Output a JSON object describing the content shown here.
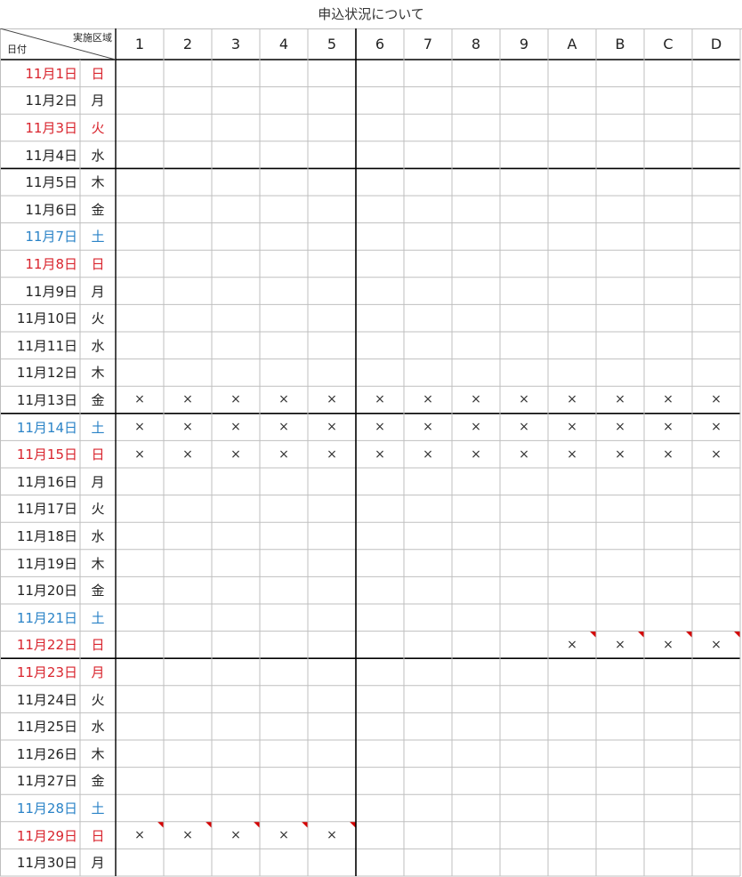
{
  "title": "申込状況について",
  "header": {
    "date_label": "日付",
    "area_label": "実施区域"
  },
  "areas": [
    "1",
    "2",
    "3",
    "4",
    "5",
    "6",
    "7",
    "8",
    "9",
    "A",
    "B",
    "C",
    "D"
  ],
  "rows": [
    {
      "date": "11月1日",
      "dow": "日",
      "color": "red",
      "marks": []
    },
    {
      "date": "11月2日",
      "dow": "月",
      "color": "",
      "marks": []
    },
    {
      "date": "11月3日",
      "dow": "火",
      "color": "red",
      "marks": []
    },
    {
      "date": "11月4日",
      "dow": "水",
      "color": "",
      "marks": []
    },
    {
      "date": "11月5日",
      "dow": "木",
      "color": "",
      "marks": []
    },
    {
      "date": "11月6日",
      "dow": "金",
      "color": "",
      "marks": []
    },
    {
      "date": "11月7日",
      "dow": "土",
      "color": "blue",
      "marks": []
    },
    {
      "date": "11月8日",
      "dow": "日",
      "color": "red",
      "marks": []
    },
    {
      "date": "11月9日",
      "dow": "月",
      "color": "",
      "marks": []
    },
    {
      "date": "11月10日",
      "dow": "火",
      "color": "",
      "marks": []
    },
    {
      "date": "11月11日",
      "dow": "水",
      "color": "",
      "marks": []
    },
    {
      "date": "11月12日",
      "dow": "木",
      "color": "",
      "marks": []
    },
    {
      "date": "11月13日",
      "dow": "金",
      "color": "",
      "marks": [
        "1",
        "2",
        "3",
        "4",
        "5",
        "6",
        "7",
        "8",
        "9",
        "A",
        "B",
        "C",
        "D"
      ]
    },
    {
      "date": "11月14日",
      "dow": "土",
      "color": "blue",
      "marks": [
        "1",
        "2",
        "3",
        "4",
        "5",
        "6",
        "7",
        "8",
        "9",
        "A",
        "B",
        "C",
        "D"
      ]
    },
    {
      "date": "11月15日",
      "dow": "日",
      "color": "red",
      "marks": [
        "1",
        "2",
        "3",
        "4",
        "5",
        "6",
        "7",
        "8",
        "9",
        "A",
        "B",
        "C",
        "D"
      ]
    },
    {
      "date": "11月16日",
      "dow": "月",
      "color": "",
      "marks": []
    },
    {
      "date": "11月17日",
      "dow": "火",
      "color": "",
      "marks": []
    },
    {
      "date": "11月18日",
      "dow": "水",
      "color": "",
      "marks": []
    },
    {
      "date": "11月19日",
      "dow": "木",
      "color": "",
      "marks": []
    },
    {
      "date": "11月20日",
      "dow": "金",
      "color": "",
      "marks": []
    },
    {
      "date": "11月21日",
      "dow": "土",
      "color": "blue",
      "marks": []
    },
    {
      "date": "11月22日",
      "dow": "日",
      "color": "red",
      "marks": [
        "A",
        "B",
        "C",
        "D"
      ],
      "comments": [
        "A",
        "B",
        "C",
        "D"
      ]
    },
    {
      "date": "11月23日",
      "dow": "月",
      "color": "red",
      "marks": []
    },
    {
      "date": "11月24日",
      "dow": "火",
      "color": "",
      "marks": []
    },
    {
      "date": "11月25日",
      "dow": "水",
      "color": "",
      "marks": []
    },
    {
      "date": "11月26日",
      "dow": "木",
      "color": "",
      "marks": []
    },
    {
      "date": "11月27日",
      "dow": "金",
      "color": "",
      "marks": []
    },
    {
      "date": "11月28日",
      "dow": "土",
      "color": "blue",
      "marks": []
    },
    {
      "date": "11月29日",
      "dow": "日",
      "color": "red",
      "marks": [
        "1",
        "2",
        "3",
        "4",
        "5"
      ],
      "comments": [
        "1",
        "2",
        "3",
        "4",
        "5"
      ]
    },
    {
      "date": "11月30日",
      "dow": "月",
      "color": "",
      "marks": []
    }
  ],
  "mark_symbol": "×",
  "colors": {
    "holiday": "#d9242d",
    "saturday": "#2a83c7",
    "comment_flag": "#d40000",
    "grid": "#bfbfbf",
    "heavy": "#000000"
  }
}
